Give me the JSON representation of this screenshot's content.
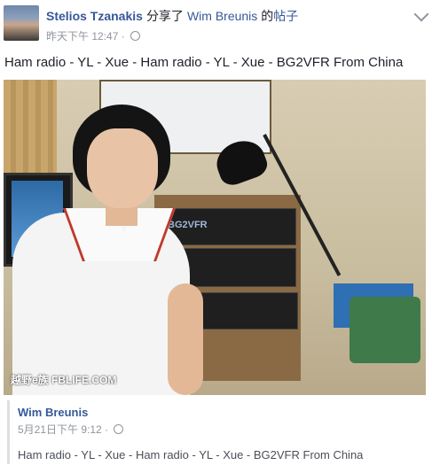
{
  "header": {
    "author": "Stelios Tzanakis",
    "shared_verb": "分享了",
    "target": "Wim Breunis",
    "possessive": "的",
    "post_kind": "帖子",
    "timestamp": "昨天下午 12:47",
    "separator": "·",
    "audience_icon": "globe-icon",
    "menu_icon": "chevron-down-icon"
  },
  "post": {
    "text": "Ham radio - YL - Xue - Ham radio - YL - Xue - BG2VFR From China"
  },
  "photo": {
    "watermark": "越野e族 FBLIFE.COM",
    "radio_label": "BG2VFR"
  },
  "shared": {
    "author": "Wim Breunis",
    "timestamp": "5月21日下午 9:12",
    "separator": "·",
    "audience_icon": "globe-icon",
    "text": "Ham radio - YL - Xue - Ham radio - YL - Xue - BG2VFR From China"
  },
  "colors": {
    "link": "#365899",
    "meta": "#90949c",
    "text": "#1d2129"
  }
}
